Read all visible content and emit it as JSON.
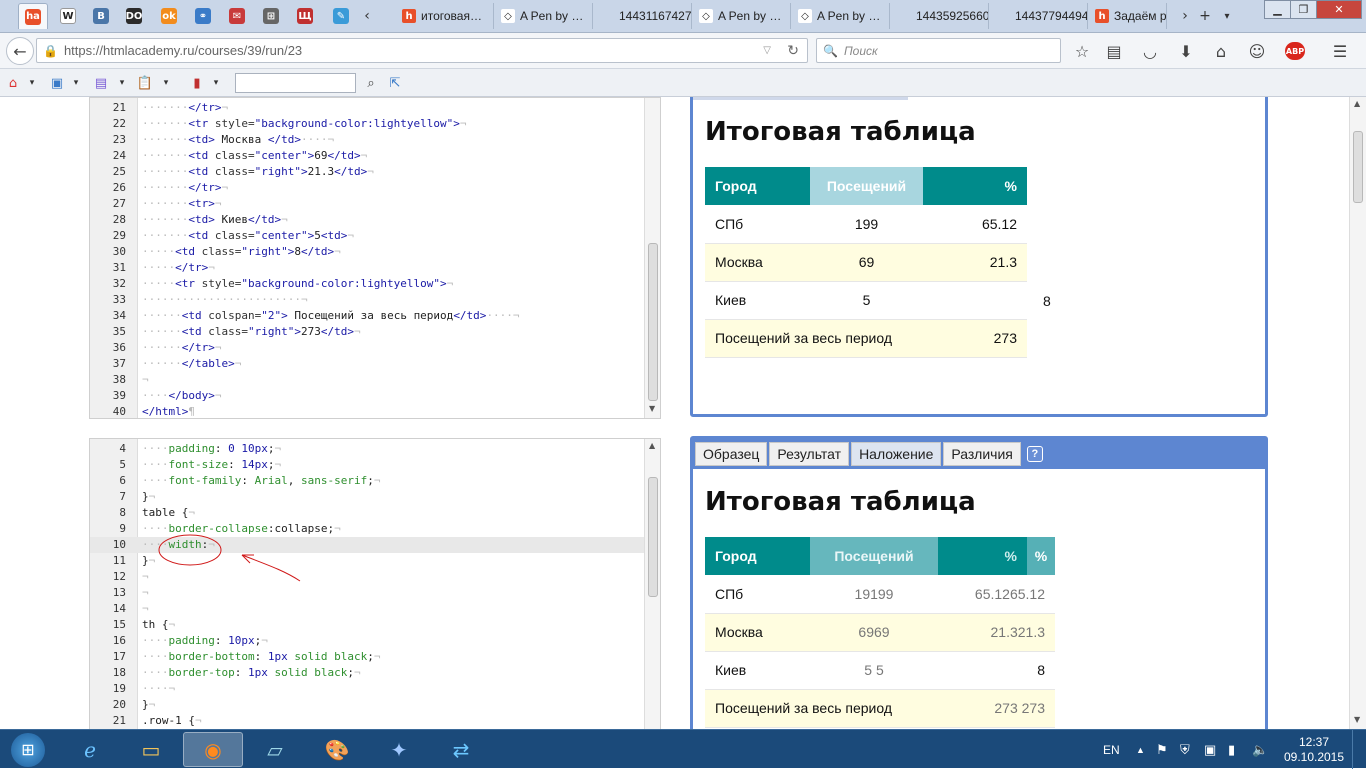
{
  "tabs": {
    "pinned": [
      {
        "icon": "htmlacademy-icon",
        "text": "ha",
        "color": "#e8502a"
      },
      {
        "icon": "wikipedia-icon",
        "text": "W",
        "color": "#ffffff"
      },
      {
        "icon": "vk-icon",
        "text": "B",
        "color": "#4a76a8"
      },
      {
        "icon": "do-icon",
        "text": "DO",
        "color": "#2b2b2b"
      },
      {
        "icon": "odnoklassniki-icon",
        "text": "ok",
        "color": "#f28c1d"
      },
      {
        "icon": "link-icon",
        "text": "⚭",
        "color": "#3a7bc8"
      },
      {
        "icon": "mail-icon",
        "text": "✉",
        "color": "#c83a3a"
      },
      {
        "icon": "bookmark-icon",
        "text": "⊞",
        "color": "#666"
      },
      {
        "icon": "book-icon",
        "text": "Щ",
        "color": "#c03030"
      },
      {
        "icon": "pencil-icon",
        "text": "✎",
        "color": "#3a9bd8"
      }
    ],
    "open": [
      {
        "label": "итоговая…",
        "icon": "htmlacademy-icon"
      },
      {
        "label": "A Pen by …",
        "icon": "codepen-icon"
      },
      {
        "label": "144311674276…",
        "icon": "blank-icon"
      },
      {
        "label": "A Pen by …",
        "icon": "codepen-icon"
      },
      {
        "label": "A Pen by …",
        "icon": "codepen-icon"
      },
      {
        "label": "144359256604…",
        "icon": "blank-icon"
      },
      {
        "label": "144377944949…",
        "icon": "blank-icon"
      },
      {
        "label": "Задаём р",
        "icon": "htmlacademy-icon"
      }
    ]
  },
  "nav": {
    "url": "https://htmlacademy.ru/courses/39/run/23",
    "url_host": "htmlacademy.ru",
    "search_placeholder": "Поиск"
  },
  "editor_html": {
    "lines": [
      {
        "n": "21",
        "ws": "·······",
        "code": [
          [
            "tg",
            "</tr>"
          ],
          [
            "ws",
            "¬"
          ]
        ]
      },
      {
        "n": "22",
        "ws": "·······",
        "code": [
          [
            "tg",
            "<tr"
          ],
          [
            "at",
            " style="
          ],
          [
            "sv",
            "\"background-color:lightyellow\""
          ],
          [
            "tg",
            ">"
          ],
          [
            "ws",
            "¬"
          ]
        ]
      },
      {
        "n": "23",
        "ws": "·······",
        "code": [
          [
            "tg",
            "<td>"
          ],
          [
            "tx",
            " Москва "
          ],
          [
            "tg",
            "</td>"
          ],
          [
            "ws",
            "····¬"
          ]
        ]
      },
      {
        "n": "24",
        "ws": "·······",
        "code": [
          [
            "tg",
            "<td"
          ],
          [
            "at",
            " class="
          ],
          [
            "sv",
            "\"center\""
          ],
          [
            "tg",
            ">"
          ],
          [
            "tx",
            "69"
          ],
          [
            "tg",
            "</td>"
          ],
          [
            "ws",
            "¬"
          ]
        ]
      },
      {
        "n": "25",
        "ws": "·······",
        "code": [
          [
            "tg",
            "<td"
          ],
          [
            "at",
            " class="
          ],
          [
            "sv",
            "\"right\""
          ],
          [
            "tg",
            ">"
          ],
          [
            "tx",
            "21.3"
          ],
          [
            "tg",
            "</td>"
          ],
          [
            "ws",
            "¬"
          ]
        ]
      },
      {
        "n": "26",
        "ws": "·······",
        "code": [
          [
            "tg",
            "</tr>"
          ],
          [
            "ws",
            "¬"
          ]
        ]
      },
      {
        "n": "27",
        "ws": "·······",
        "code": [
          [
            "tg",
            "<tr>"
          ],
          [
            "ws",
            "¬"
          ]
        ]
      },
      {
        "n": "28",
        "ws": "·······",
        "code": [
          [
            "tg",
            "<td>"
          ],
          [
            "tx",
            " Киев"
          ],
          [
            "tg",
            "</td>"
          ],
          [
            "ws",
            "¬"
          ]
        ]
      },
      {
        "n": "29",
        "ws": "·······",
        "code": [
          [
            "tg",
            "<td"
          ],
          [
            "at",
            " class="
          ],
          [
            "sv",
            "\"center\""
          ],
          [
            "tg",
            ">"
          ],
          [
            "tx",
            "5"
          ],
          [
            "tg",
            "<td>"
          ],
          [
            "ws",
            "¬"
          ]
        ]
      },
      {
        "n": "30",
        "ws": "·····",
        "code": [
          [
            "tg",
            "<td"
          ],
          [
            "at",
            " class="
          ],
          [
            "sv",
            "\"right\""
          ],
          [
            "tg",
            ">"
          ],
          [
            "tx",
            "8"
          ],
          [
            "tg",
            "</td>"
          ],
          [
            "ws",
            "¬"
          ]
        ]
      },
      {
        "n": "31",
        "ws": "·····",
        "code": [
          [
            "tg",
            "</tr>"
          ],
          [
            "ws",
            "¬"
          ]
        ]
      },
      {
        "n": "32",
        "ws": "·····",
        "code": [
          [
            "tg",
            "<tr"
          ],
          [
            "at",
            " style="
          ],
          [
            "sv",
            "\"background-color:lightyellow\""
          ],
          [
            "tg",
            ">"
          ],
          [
            "ws",
            "¬"
          ]
        ]
      },
      {
        "n": "33",
        "ws": "························",
        "code": [
          [
            "ws",
            "¬"
          ]
        ]
      },
      {
        "n": "34",
        "ws": "······",
        "code": [
          [
            "tg",
            "<td"
          ],
          [
            "at",
            " colspan="
          ],
          [
            "sv",
            "\"2\""
          ],
          [
            "tg",
            ">"
          ],
          [
            "tx",
            " Посещений за весь период"
          ],
          [
            "tg",
            "</td>"
          ],
          [
            "ws",
            "····¬"
          ]
        ]
      },
      {
        "n": "35",
        "ws": "······",
        "code": [
          [
            "tg",
            "<td"
          ],
          [
            "at",
            " class="
          ],
          [
            "sv",
            "\"right\""
          ],
          [
            "tg",
            ">"
          ],
          [
            "tx",
            "273"
          ],
          [
            "tg",
            "</td>"
          ],
          [
            "ws",
            "¬"
          ]
        ]
      },
      {
        "n": "36",
        "ws": "······",
        "code": [
          [
            "tg",
            "</tr>"
          ],
          [
            "ws",
            "¬"
          ]
        ]
      },
      {
        "n": "37",
        "ws": "······",
        "code": [
          [
            "tg",
            "</table>"
          ],
          [
            "ws",
            "¬"
          ]
        ]
      },
      {
        "n": "38",
        "ws": "",
        "code": [
          [
            "ws",
            "¬"
          ]
        ]
      },
      {
        "n": "39",
        "ws": "····",
        "code": [
          [
            "tg",
            "</body>"
          ],
          [
            "ws",
            "¬"
          ]
        ]
      },
      {
        "n": "40",
        "ws": "",
        "code": [
          [
            "tg",
            "</html>"
          ],
          [
            "ws",
            "¶"
          ]
        ]
      }
    ]
  },
  "editor_css": {
    "lines": [
      {
        "n": "4",
        "ws": "····",
        "code": [
          [
            "pr",
            "padding"
          ],
          [
            "pn",
            ": "
          ],
          [
            "vl",
            "0 10px"
          ],
          [
            "pn",
            ";"
          ],
          [
            "ws",
            "¬"
          ]
        ]
      },
      {
        "n": "5",
        "ws": "····",
        "code": [
          [
            "pr",
            "font-size"
          ],
          [
            "pn",
            ": "
          ],
          [
            "vl",
            "14px"
          ],
          [
            "pn",
            ";"
          ],
          [
            "ws",
            "¬"
          ]
        ]
      },
      {
        "n": "6",
        "ws": "····",
        "code": [
          [
            "pr",
            "font-family"
          ],
          [
            "pn",
            ": "
          ],
          [
            "pr",
            "Arial"
          ],
          [
            "pn",
            ", "
          ],
          [
            "pr",
            "sans-serif"
          ],
          [
            "pn",
            ";"
          ],
          [
            "ws",
            "¬"
          ]
        ]
      },
      {
        "n": "7",
        "ws": "",
        "code": [
          [
            "pn",
            "}"
          ],
          [
            "ws",
            "¬"
          ]
        ]
      },
      {
        "n": "8",
        "ws": "",
        "code": [
          [
            "sel",
            "table"
          ],
          [
            "pn",
            " {"
          ],
          [
            "ws",
            "¬"
          ]
        ]
      },
      {
        "n": "9",
        "ws": "····",
        "code": [
          [
            "pr",
            "border-collapse"
          ],
          [
            "pn",
            ":"
          ],
          [
            "sel",
            "collapse"
          ],
          [
            "pn",
            ";"
          ],
          [
            "ws",
            "¬"
          ]
        ]
      },
      {
        "n": "10",
        "ws": "····",
        "code": [
          [
            "pr",
            "width"
          ],
          [
            "pn",
            ":"
          ],
          [
            "ws",
            "¬"
          ]
        ],
        "highlight": true
      },
      {
        "n": "11",
        "ws": "",
        "code": [
          [
            "pn",
            "}"
          ],
          [
            "ws",
            "¬"
          ]
        ]
      },
      {
        "n": "12",
        "ws": "",
        "code": [
          [
            "ws",
            "¬"
          ]
        ]
      },
      {
        "n": "13",
        "ws": "",
        "code": [
          [
            "ws",
            "¬"
          ]
        ]
      },
      {
        "n": "14",
        "ws": "",
        "code": [
          [
            "ws",
            "¬"
          ]
        ]
      },
      {
        "n": "15",
        "ws": "",
        "code": [
          [
            "sel",
            "th"
          ],
          [
            "pn",
            " {"
          ],
          [
            "ws",
            "¬"
          ]
        ]
      },
      {
        "n": "16",
        "ws": "····",
        "code": [
          [
            "pr",
            "padding"
          ],
          [
            "pn",
            ": "
          ],
          [
            "vl",
            "10px"
          ],
          [
            "pn",
            ";"
          ],
          [
            "ws",
            "¬"
          ]
        ]
      },
      {
        "n": "17",
        "ws": "····",
        "code": [
          [
            "pr",
            "border-bottom"
          ],
          [
            "pn",
            ": "
          ],
          [
            "vl",
            "1px"
          ],
          [
            "pr",
            " solid black"
          ],
          [
            "pn",
            ";"
          ],
          [
            "ws",
            "¬"
          ]
        ]
      },
      {
        "n": "18",
        "ws": "····",
        "code": [
          [
            "pr",
            "border-top"
          ],
          [
            "pn",
            ": "
          ],
          [
            "vl",
            "1px"
          ],
          [
            "pr",
            " solid black"
          ],
          [
            "pn",
            ";"
          ],
          [
            "ws",
            "¬"
          ]
        ]
      },
      {
        "n": "19",
        "ws": "····",
        "code": [
          [
            "ws",
            "¬"
          ]
        ]
      },
      {
        "n": "20",
        "ws": "",
        "code": [
          [
            "pn",
            "}"
          ],
          [
            "ws",
            "¬"
          ]
        ]
      },
      {
        "n": "21",
        "ws": "",
        "code": [
          [
            "sel",
            ".row-1"
          ],
          [
            "pn",
            " {"
          ],
          [
            "ws",
            "¬"
          ]
        ]
      }
    ]
  },
  "result": {
    "title": "Итоговая таблица",
    "headers": [
      "Город",
      "Посещений",
      "%"
    ],
    "rows": [
      {
        "city": "СПб",
        "visits": "199",
        "pct": "65.12"
      },
      {
        "city": "Москва",
        "visits": "69",
        "pct": "21.3"
      },
      {
        "city": "Киев",
        "visits": "5",
        "pct": "8"
      }
    ],
    "total_label": "Посещений за весь период",
    "total_value": "273"
  },
  "overlay": {
    "tabs": [
      "Образец",
      "Результат",
      "Наложение",
      "Различия"
    ],
    "active_tab": "Наложение",
    "help": "?",
    "title": "Итоговая таблица",
    "headers": [
      "Город",
      "Посещений",
      "%",
      "%"
    ],
    "rows": [
      {
        "city": "СПб",
        "visits": "19199",
        "pct": "65.1265.12"
      },
      {
        "city": "Москва",
        "visits": "6969",
        "pct": "21.321.3"
      },
      {
        "city": "Киев",
        "visits": "5 5",
        "pct": "8"
      }
    ],
    "total_label": "Посещений за весь период",
    "total_value": "273 273"
  },
  "taskbar": {
    "lang": "EN",
    "time": "12:37",
    "date": "09.10.2015"
  },
  "colors": {
    "teal": "#008b8b",
    "lightyellow": "#fffde0",
    "panel_border": "#5d86d1"
  }
}
